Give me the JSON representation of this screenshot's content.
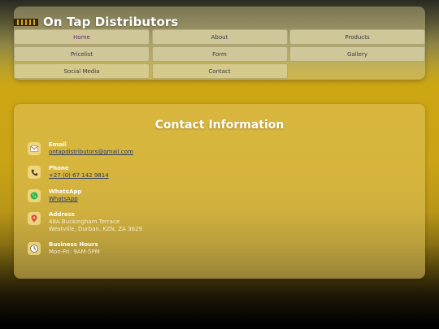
{
  "header": {
    "brand_name": "On Tap Distributors",
    "nav": [
      {
        "label": "Home"
      },
      {
        "label": "About"
      },
      {
        "label": "Products"
      },
      {
        "label": "Pricelist"
      },
      {
        "label": "Form"
      },
      {
        "label": "Gallery"
      },
      {
        "label": "Social Media"
      },
      {
        "label": "Contact"
      }
    ]
  },
  "contact": {
    "title": "Contact Information",
    "items": [
      {
        "icon": "email-icon",
        "label": "Email",
        "value": "ontapdistributors@gmail.com"
      },
      {
        "icon": "phone-icon",
        "label": "Phone",
        "value": "+27 (0) 67 142 9814"
      },
      {
        "icon": "whatsapp-icon",
        "label": "WhatsApp",
        "value": "WhatsApp"
      },
      {
        "icon": "location-pin-icon",
        "label": "Address",
        "line1": "48A Buckingham Terrace",
        "line2": "Westville, Durban, KZN, ZA 3629"
      },
      {
        "icon": "clock-icon",
        "label": "Business Hours",
        "value": "Mon-Fri: 9AM-5PM"
      }
    ]
  },
  "colors": {
    "accent_gold": "#cda614",
    "link": "#2a3a6a",
    "active_nav_text": "#5a2e6a"
  }
}
